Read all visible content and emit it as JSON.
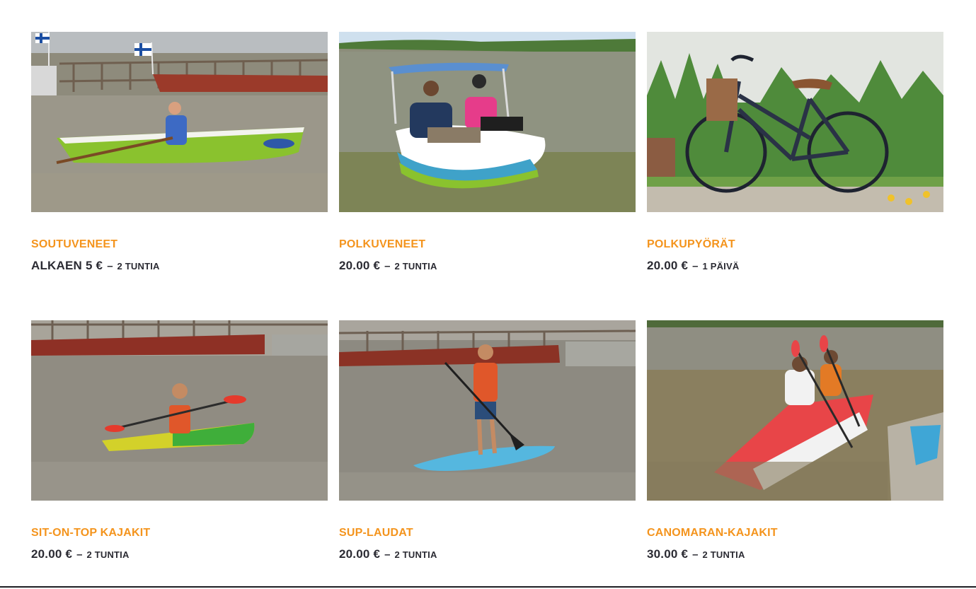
{
  "products": [
    {
      "title": "SOUTUVENEET",
      "price": "ALKAEN 5 €",
      "separator": "–",
      "unit": "2 TUNTIA",
      "image_icon": "rowboat-photo"
    },
    {
      "title": "POLKUVENEET",
      "price": "20.00 €",
      "separator": "–",
      "unit": "2 TUNTIA",
      "image_icon": "pedal-boat-photo"
    },
    {
      "title": "POLKUPYÖRÄT",
      "price": "20.00 €",
      "separator": "–",
      "unit": "1 PÄIVÄ",
      "image_icon": "bicycle-photo"
    },
    {
      "title": "SIT-ON-TOP KAJAKIT",
      "price": "20.00 €",
      "separator": "–",
      "unit": "2 TUNTIA",
      "image_icon": "kayak-photo"
    },
    {
      "title": "SUP-LAUDAT",
      "price": "20.00 €",
      "separator": "–",
      "unit": "2 TUNTIA",
      "image_icon": "sup-board-photo"
    },
    {
      "title": "CANOMARAN-KAJAKIT",
      "price": "30.00 €",
      "separator": "–",
      "unit": "2 TUNTIA",
      "image_icon": "canomaran-photo"
    }
  ],
  "colors": {
    "title": "#f4941d",
    "price": "#2b2b33",
    "lake": "#8d8a76",
    "sky": "#dfe6ee"
  }
}
